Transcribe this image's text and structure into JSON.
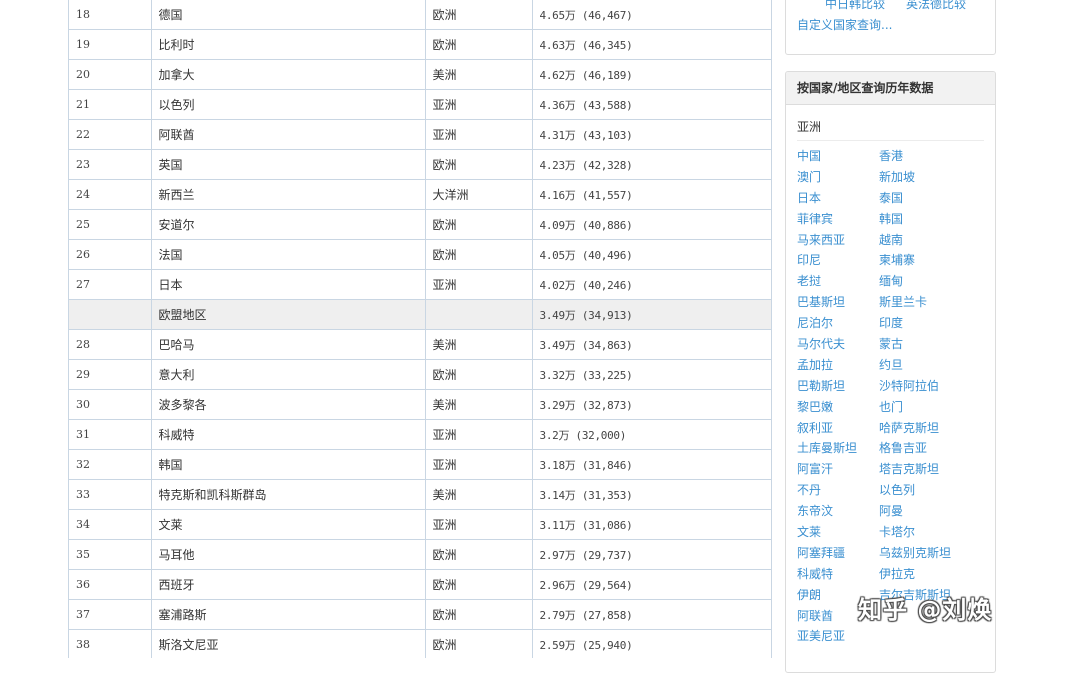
{
  "table": {
    "rows": [
      {
        "rank": "18",
        "country": "德国",
        "region": "欧洲",
        "value": "4.65万 (46,467)"
      },
      {
        "rank": "19",
        "country": "比利时",
        "region": "欧洲",
        "value": "4.63万 (46,345)"
      },
      {
        "rank": "20",
        "country": "加拿大",
        "region": "美洲",
        "value": "4.62万 (46,189)"
      },
      {
        "rank": "21",
        "country": "以色列",
        "region": "亚洲",
        "value": "4.36万 (43,588)"
      },
      {
        "rank": "22",
        "country": "阿联酋",
        "region": "亚洲",
        "value": "4.31万 (43,103)"
      },
      {
        "rank": "23",
        "country": "英国",
        "region": "欧洲",
        "value": "4.23万 (42,328)"
      },
      {
        "rank": "24",
        "country": "新西兰",
        "region": "大洋洲",
        "value": "4.16万 (41,557)"
      },
      {
        "rank": "25",
        "country": "安道尔",
        "region": "欧洲",
        "value": "4.09万 (40,886)"
      },
      {
        "rank": "26",
        "country": "法国",
        "region": "欧洲",
        "value": "4.05万 (40,496)"
      },
      {
        "rank": "27",
        "country": "日本",
        "region": "亚洲",
        "value": "4.02万 (40,246)"
      },
      {
        "rank": "",
        "country": "欧盟地区",
        "region": "",
        "value": "3.49万 (34,913)",
        "aggregate": true
      },
      {
        "rank": "28",
        "country": "巴哈马",
        "region": "美洲",
        "value": "3.49万 (34,863)"
      },
      {
        "rank": "29",
        "country": "意大利",
        "region": "欧洲",
        "value": "3.32万 (33,225)"
      },
      {
        "rank": "30",
        "country": "波多黎各",
        "region": "美洲",
        "value": "3.29万 (32,873)"
      },
      {
        "rank": "31",
        "country": "科威特",
        "region": "亚洲",
        "value": "3.2万 (32,000)"
      },
      {
        "rank": "32",
        "country": "韩国",
        "region": "亚洲",
        "value": "3.18万 (31,846)"
      },
      {
        "rank": "33",
        "country": "特克斯和凯科斯群岛",
        "region": "美洲",
        "value": "3.14万 (31,353)"
      },
      {
        "rank": "34",
        "country": "文莱",
        "region": "亚洲",
        "value": "3.11万 (31,086)"
      },
      {
        "rank": "35",
        "country": "马耳他",
        "region": "欧洲",
        "value": "2.97万 (29,737)"
      },
      {
        "rank": "36",
        "country": "西班牙",
        "region": "欧洲",
        "value": "2.96万 (29,564)"
      },
      {
        "rank": "37",
        "country": "塞浦路斯",
        "region": "欧洲",
        "value": "2.79万 (27,858)"
      },
      {
        "rank": "38",
        "country": "斯洛文尼亚",
        "region": "欧洲",
        "value": "2.59万 (25,940)"
      }
    ]
  },
  "top_panel": {
    "compare_a": "中日韩比较",
    "compare_b": "英法德比较",
    "custom_link": "自定义国家查询..."
  },
  "history_panel": {
    "title": "按国家/地区查询历年数据",
    "region": "亚洲",
    "countries": [
      [
        "中国",
        "香港"
      ],
      [
        "澳门",
        "新加坡"
      ],
      [
        "日本",
        "泰国"
      ],
      [
        "菲律宾",
        "韩国"
      ],
      [
        "马来西亚",
        "越南"
      ],
      [
        "印尼",
        "柬埔寨"
      ],
      [
        "老挝",
        "缅甸"
      ],
      [
        "巴基斯坦",
        "斯里兰卡"
      ],
      [
        "尼泊尔",
        "印度"
      ],
      [
        "马尔代夫",
        "蒙古"
      ],
      [
        "孟加拉",
        "约旦"
      ],
      [
        "巴勒斯坦",
        "沙特阿拉伯"
      ],
      [
        "黎巴嫩",
        "也门"
      ],
      [
        "叙利亚",
        "哈萨克斯坦"
      ],
      [
        "土库曼斯坦",
        "格鲁吉亚"
      ],
      [
        "阿富汗",
        "塔吉克斯坦"
      ],
      [
        "不丹",
        "以色列"
      ],
      [
        "东帝汶",
        "阿曼"
      ],
      [
        "文莱",
        "卡塔尔"
      ],
      [
        "阿塞拜疆",
        "乌兹别克斯坦"
      ],
      [
        "科威特",
        "伊拉克"
      ],
      [
        "伊朗",
        "吉尔吉斯斯坦"
      ],
      [
        "阿联酋",
        ""
      ],
      [
        "亚美尼亚",
        ""
      ]
    ]
  },
  "watermark": "知乎 @刘焕",
  "colors": {
    "link": "#3a8fd0",
    "border": "#c9d6e3",
    "aggregate_row": "#efefef"
  }
}
